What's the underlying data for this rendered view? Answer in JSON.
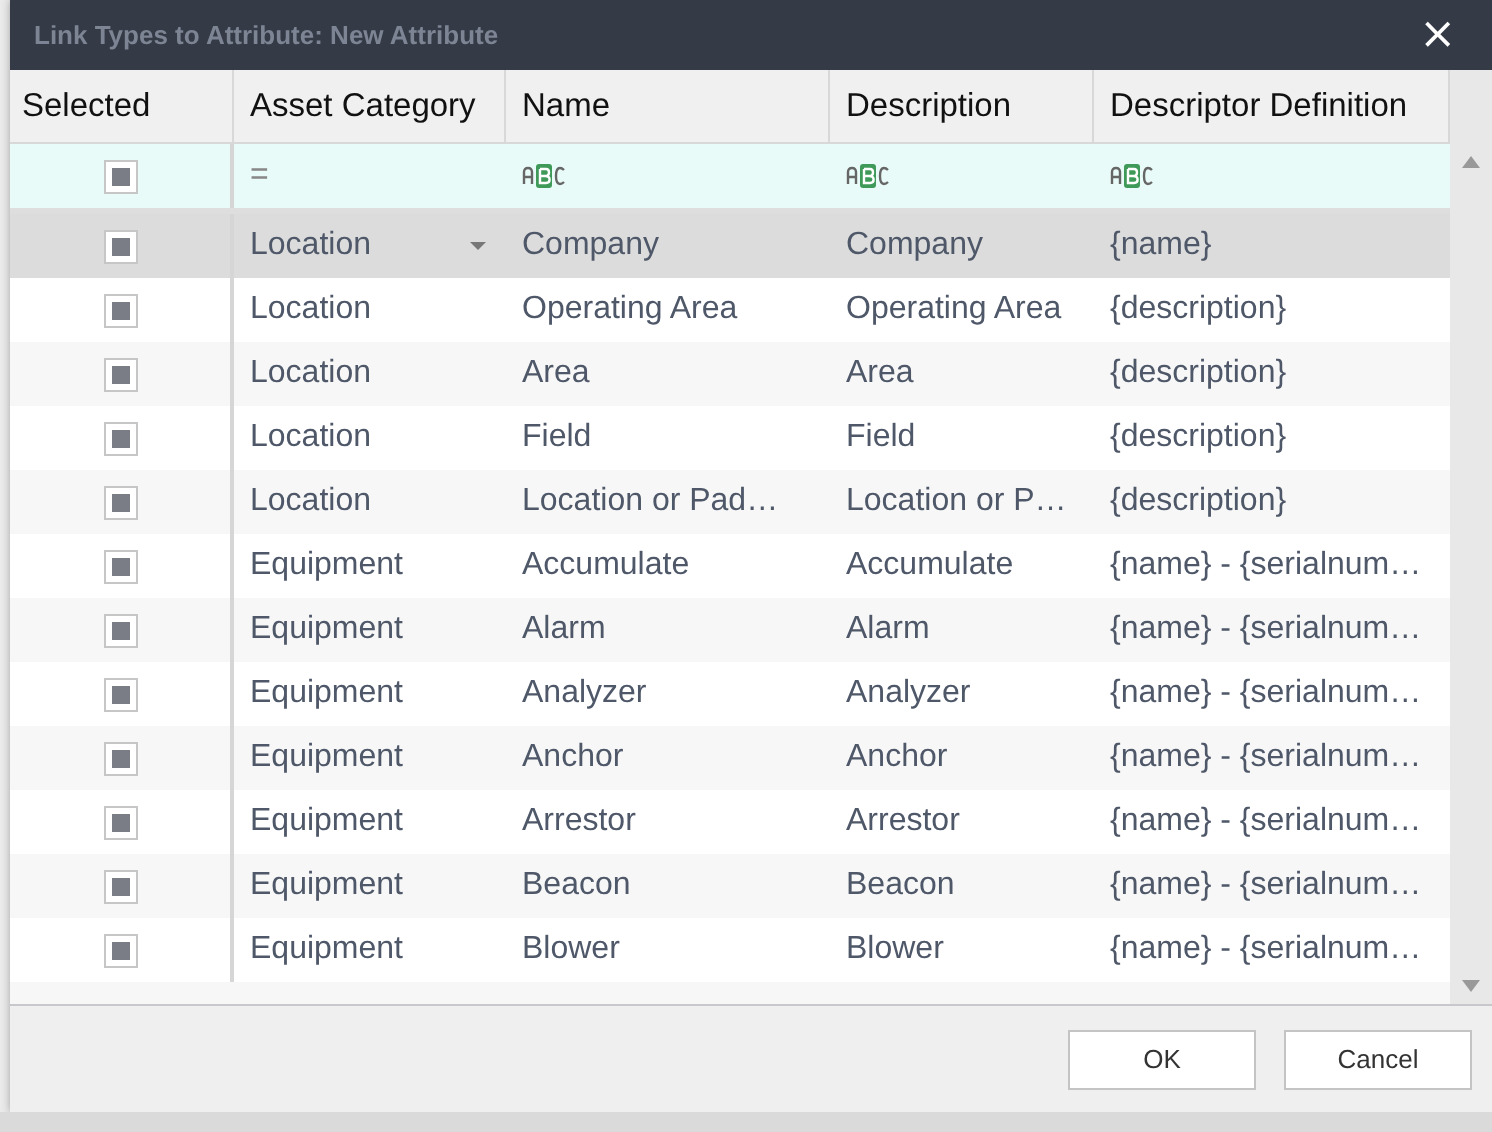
{
  "window": {
    "title": "Link Types to Attribute: New Attribute",
    "close": "×"
  },
  "table": {
    "columns": [
      "Selected",
      "Asset Category",
      "Name",
      "Description",
      "Descriptor Definition"
    ],
    "filter_row": {
      "selected_indeterminate": true,
      "category_operator": "="
    },
    "rows": [
      {
        "indeterminate": true,
        "selected": true,
        "category": "Location",
        "name": "Company",
        "description": "Company",
        "descriptor": "{name}"
      },
      {
        "indeterminate": true,
        "selected": false,
        "category": "Location",
        "name": "Operating Area",
        "description": "Operating Area",
        "descriptor": "{description}"
      },
      {
        "indeterminate": true,
        "selected": false,
        "category": "Location",
        "name": "Area",
        "description": "Area",
        "descriptor": "{description}"
      },
      {
        "indeterminate": true,
        "selected": false,
        "category": "Location",
        "name": "Field",
        "description": "Field",
        "descriptor": "{description}"
      },
      {
        "indeterminate": true,
        "selected": false,
        "category": "Location",
        "name": "Location or Pad…",
        "description": "Location or P…",
        "descriptor": "{description}"
      },
      {
        "indeterminate": true,
        "selected": false,
        "category": "Equipment",
        "name": "Accumulate",
        "description": "Accumulate",
        "descriptor": "{name} - {serialnum…"
      },
      {
        "indeterminate": true,
        "selected": false,
        "category": "Equipment",
        "name": "Alarm",
        "description": "Alarm",
        "descriptor": "{name} - {serialnum…"
      },
      {
        "indeterminate": true,
        "selected": false,
        "category": "Equipment",
        "name": "Analyzer",
        "description": "Analyzer",
        "descriptor": "{name} - {serialnum…"
      },
      {
        "indeterminate": true,
        "selected": false,
        "category": "Equipment",
        "name": "Anchor",
        "description": "Anchor",
        "descriptor": "{name} - {serialnum…"
      },
      {
        "indeterminate": true,
        "selected": false,
        "category": "Equipment",
        "name": "Arrestor",
        "description": "Arrestor",
        "descriptor": "{name} - {serialnum…"
      },
      {
        "indeterminate": true,
        "selected": false,
        "category": "Equipment",
        "name": "Beacon",
        "description": "Beacon",
        "descriptor": "{name} - {serialnum…"
      },
      {
        "indeterminate": true,
        "selected": false,
        "category": "Equipment",
        "name": "Blower",
        "description": "Blower",
        "descriptor": "{name} - {serialnum…"
      }
    ]
  },
  "buttons": [
    "OK",
    "Cancel"
  ]
}
